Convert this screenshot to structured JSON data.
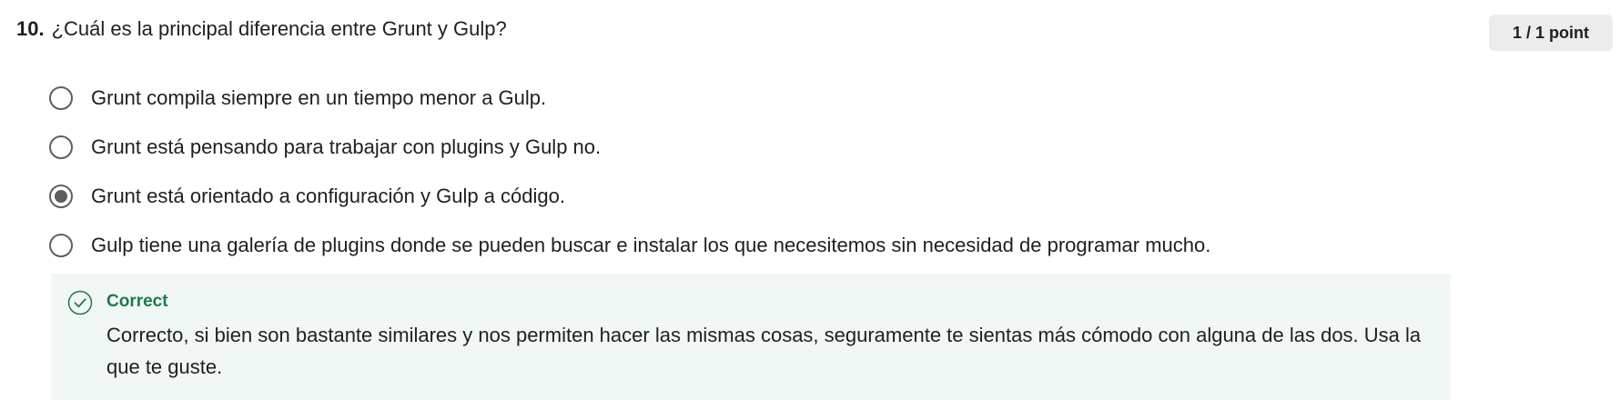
{
  "question": {
    "number": "10.",
    "text": "¿Cuál es la principal diferencia entre Grunt y Gulp?",
    "points": "1 / 1 point"
  },
  "options": [
    {
      "label": "Grunt compila siempre en un tiempo menor a Gulp.",
      "selected": false
    },
    {
      "label": "Grunt está pensando para trabajar con plugins y Gulp no.",
      "selected": false
    },
    {
      "label": "Grunt está orientado a configuración y Gulp a código.",
      "selected": true
    },
    {
      "label": "Gulp tiene una galería de plugins donde se pueden buscar e instalar los que necesitemos sin necesidad de programar mucho.",
      "selected": false
    }
  ],
  "feedback": {
    "title": "Correct",
    "text": "Correcto, si bien son bastante similares y nos permiten hacer las mismas cosas, seguramente te sientas más cómodo con alguna de las dos. Usa la que te guste.",
    "icon": "check-circle-icon"
  },
  "colors": {
    "correct": "#1f7a4d",
    "feedback_background": "#f1f7f4",
    "radio": "#5f5f5f",
    "badge_background": "#ececec"
  }
}
